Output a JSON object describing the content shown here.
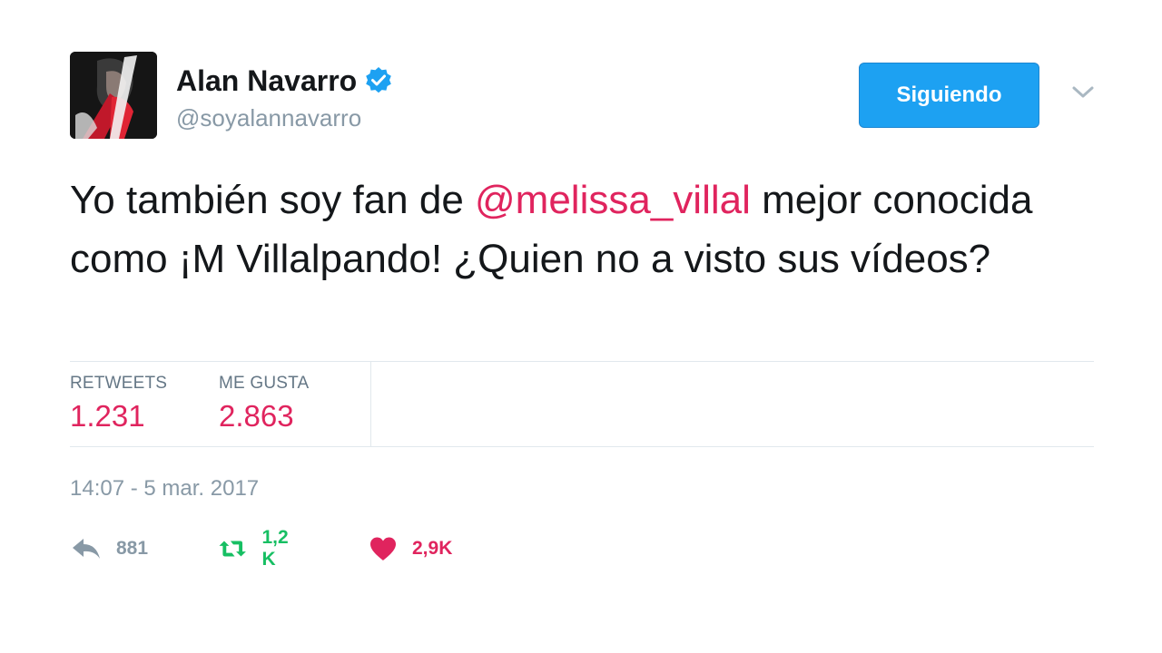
{
  "author": {
    "display_name": "Alan Navarro",
    "handle": "@soyalannavarro",
    "verified": true,
    "avatar_icon": "profile-photo"
  },
  "follow_button": {
    "label": "Siguiendo"
  },
  "menu": {
    "icon": "chevron-down-icon"
  },
  "tweet": {
    "text_before": "Yo también soy fan de ",
    "mention": "@melissa_villal",
    "text_after": " mejor conocida como ¡M Villalpando! ¿Quien no a visto sus vídeos?"
  },
  "stats": {
    "retweets_label": "RETWEETS",
    "retweets_value": "1.231",
    "likes_label": "ME GUSTA",
    "likes_value": "2.863"
  },
  "timestamp": "14:07 - 5 mar. 2017",
  "actions": {
    "reply": {
      "icon": "reply-icon",
      "count": "881"
    },
    "retweet": {
      "icon": "retweet-icon",
      "count": "1,2 K"
    },
    "like": {
      "icon": "heart-icon",
      "count": "2,9K"
    }
  },
  "colors": {
    "accent": "#1da1f2",
    "mention": "#e0245e",
    "retweet": "#17bf63",
    "muted": "#8899a6"
  }
}
